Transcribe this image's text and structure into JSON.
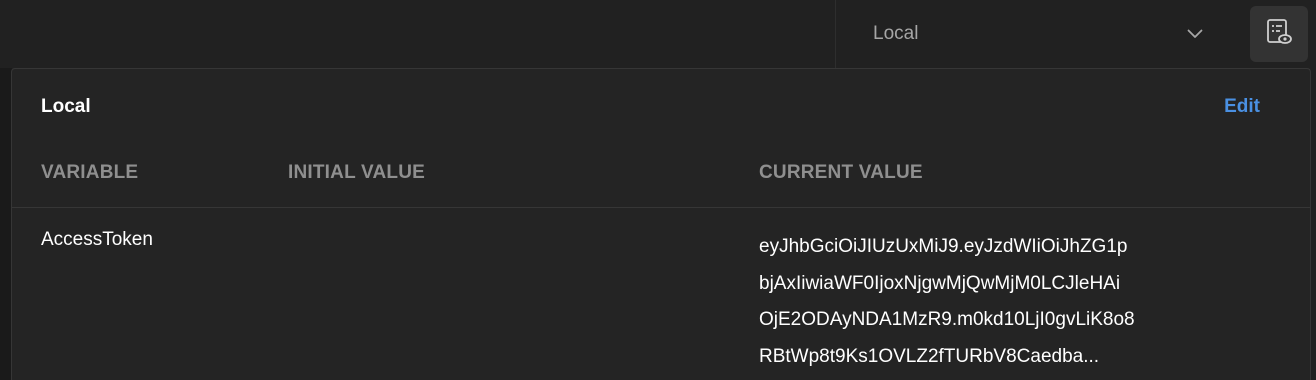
{
  "environment": {
    "selected": "Local"
  },
  "popover": {
    "title": "Local",
    "edit_label": "Edit",
    "columns": [
      "VARIABLE",
      "INITIAL VALUE",
      "CURRENT VALUE"
    ],
    "rows": [
      {
        "variable": "AccessToken",
        "initial_value": "",
        "current_value_lines": [
          "eyJhbGciOiJIUzUxMiJ9.eyJzdWIiOiJhZG1p",
          "bjAxIiwiaWF0IjoxNjgwMjQwMjM0LCJleHAi",
          "OjE2ODAyNDA1MzR9.m0kd10LjI0gvLiK8o8",
          "RBtWp8t9Ks1OVLZ2fTURbV8Caedba..."
        ]
      }
    ]
  },
  "icons": {
    "chevron": "chevron-down-icon",
    "environment_quick_look": "eye-document-icon"
  },
  "colors": {
    "background": "#212121",
    "popover_bg": "#242424",
    "accent": "#4a90e2",
    "header_text": "#8f8f8f"
  }
}
